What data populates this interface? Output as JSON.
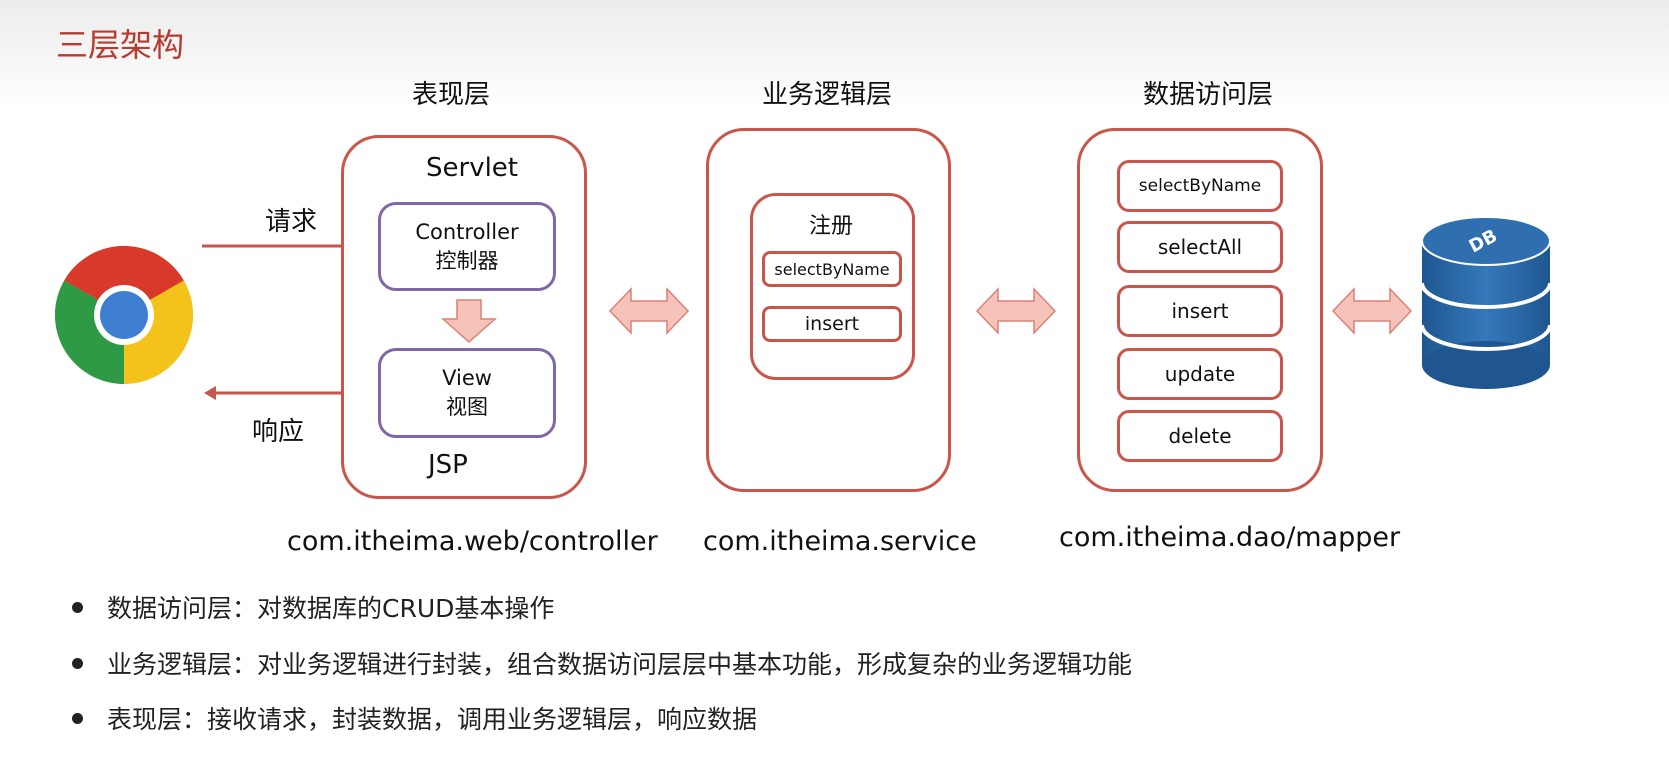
{
  "title": "三层架构",
  "layers": {
    "presentation": {
      "title": "表现层",
      "servlet": "Servlet",
      "controller_line1": "Controller",
      "controller_line2": "控制器",
      "view_line1": "View",
      "view_line2": "视图",
      "jsp": "JSP",
      "package": "com.itheima.web/controller"
    },
    "business": {
      "title": "业务逻辑层",
      "register": "注册",
      "methods": [
        "selectByName",
        "insert"
      ],
      "package": "com.itheima.service"
    },
    "data_access": {
      "title": "数据访问层",
      "methods": [
        "selectByName",
        "selectAll",
        "insert",
        "update",
        "delete"
      ],
      "package": "com.itheima.dao/mapper"
    }
  },
  "flow": {
    "request": "请求",
    "response": "响应"
  },
  "database_label": "DB",
  "bullets": [
    "数据访问层：对数据库的CRUD基本操作",
    "业务逻辑层：对业务逻辑进行封装，组合数据访问层层中基本功能，形成复杂的业务逻辑功能",
    "表现层：接收请求，封装数据，调用业务逻辑层，响应数据"
  ],
  "colors": {
    "title": "#b73a2e",
    "box_border": "#c9554b",
    "purple_border": "#8067a8",
    "arrow_fill": "#f6c3bb",
    "db_blue": "#2e6aa6"
  }
}
